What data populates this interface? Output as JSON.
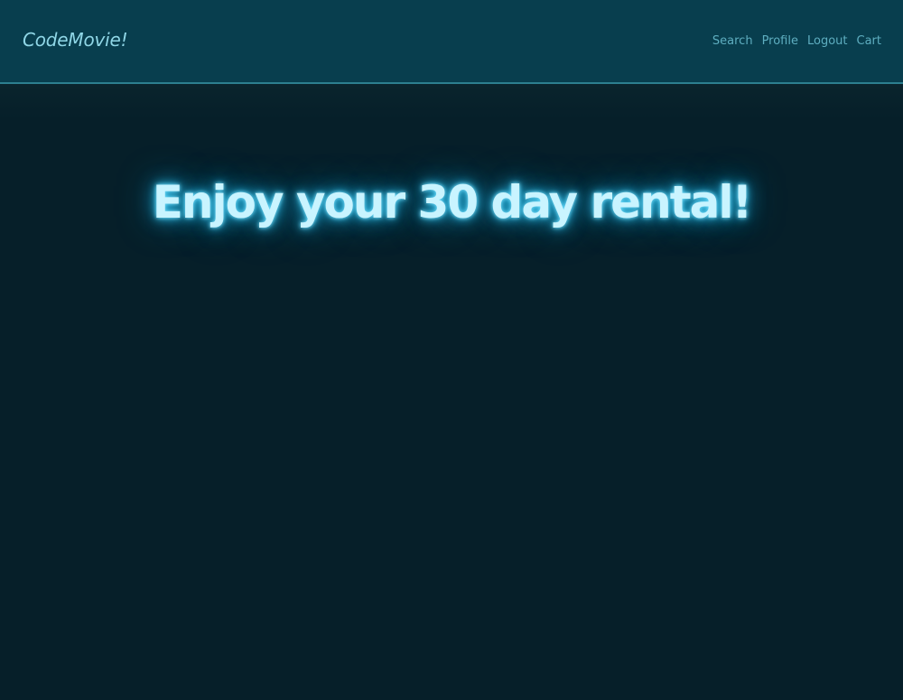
{
  "navbar": {
    "brand": "CodeMovie!",
    "links": [
      {
        "label": "Search"
      },
      {
        "label": "Profile"
      },
      {
        "label": "Logout"
      },
      {
        "label": "Cart"
      }
    ]
  },
  "main": {
    "title": "Enjoy your 30 day rental!"
  },
  "colors": {
    "navbar_bg": "#083e4e",
    "page_bg": "#061f29",
    "link": "#5eaec0",
    "brand": "#8fd6e6",
    "glow": "#33c6f2"
  }
}
